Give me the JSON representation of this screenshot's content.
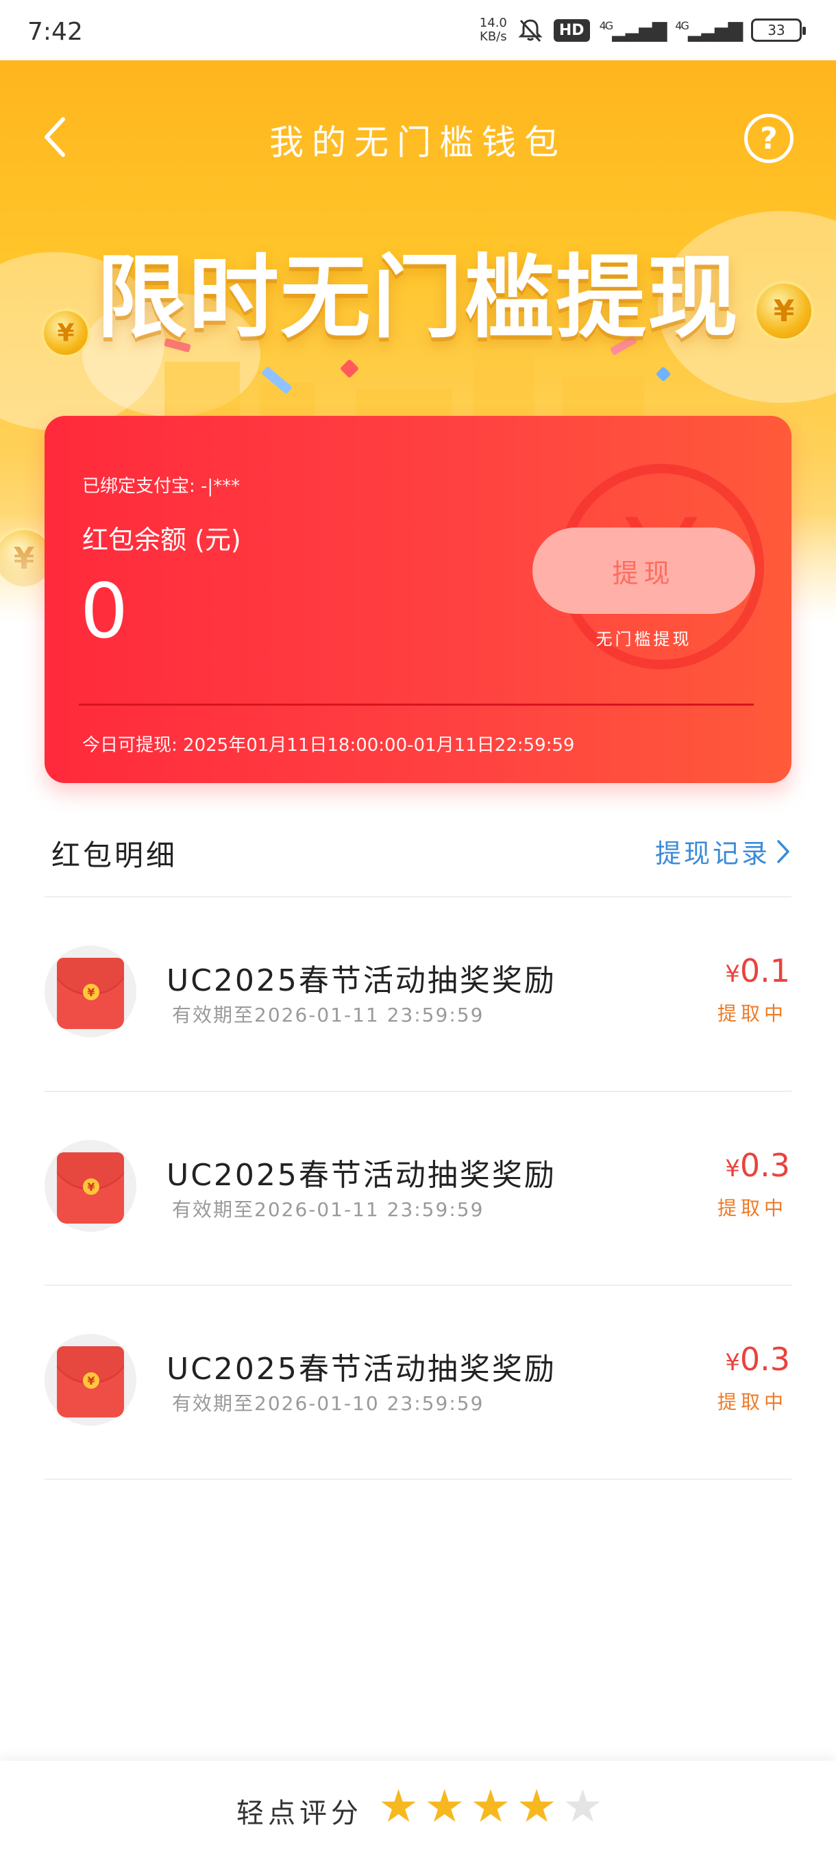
{
  "status_bar": {
    "time": "7:42",
    "net_speed_value": "14.0",
    "net_speed_unit": "KB/s",
    "hd": "HD",
    "signal1": "4G",
    "signal2": "4G",
    "battery": "33"
  },
  "header": {
    "title": "我的无门槛钱包",
    "help": "?",
    "slogan": "限时无门槛提现"
  },
  "card": {
    "bound_account": "已绑定支付宝: -|***",
    "balance_label": "红包余额 (元)",
    "balance_value": "0",
    "withdraw_button": "提现",
    "withdraw_sub": "无门槛提现",
    "today_window": "今日可提现: 2025年01月11日18:00:00-01月11日22:59:59",
    "currency_symbol": "¥"
  },
  "details": {
    "title": "红包明细",
    "records_link": "提现记录",
    "items": [
      {
        "title": "UC2025春节活动抽奖奖励",
        "expiry": "有效期至2026-01-11 23:59:59",
        "currency": "¥",
        "amount": "0.1",
        "status": "提取中"
      },
      {
        "title": "UC2025春节活动抽奖奖励",
        "expiry": "有效期至2026-01-11 23:59:59",
        "currency": "¥",
        "amount": "0.3",
        "status": "提取中"
      },
      {
        "title": "UC2025春节活动抽奖奖励",
        "expiry": "有效期至2026-01-10 23:59:59",
        "currency": "¥",
        "amount": "0.3",
        "status": "提取中"
      }
    ]
  },
  "rating": {
    "label": "轻点评分",
    "filled_stars": 4,
    "total_stars": 5
  },
  "colors": {
    "hero_yellow": "#ffc52a",
    "card_red": "#ff3a3f",
    "amount_red": "#e8433d",
    "status_orange": "#ee7a26",
    "link_blue": "#3b8bd8",
    "star_gold": "#f7b81f"
  },
  "icons": [
    "back-arrow-icon",
    "help-icon",
    "mute-bell-icon",
    "signal-icon",
    "battery-icon",
    "chevron-right-icon",
    "red-envelope-icon",
    "star-icon",
    "coin-icon"
  ]
}
